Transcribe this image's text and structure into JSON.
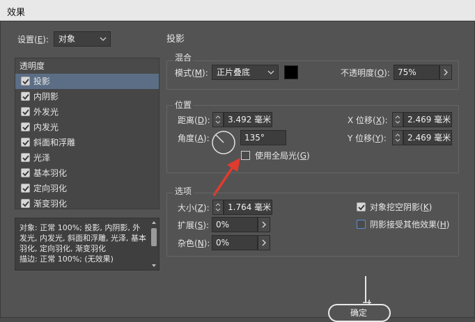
{
  "window": {
    "title": "效果"
  },
  "settings": {
    "label": "设置(",
    "key": "E",
    "suffix": "):",
    "value": "对象"
  },
  "left": {
    "header": "透明度",
    "items": [
      {
        "label": "投影",
        "checked": true,
        "selected": true
      },
      {
        "label": "内阴影",
        "checked": true,
        "selected": false
      },
      {
        "label": "外发光",
        "checked": true,
        "selected": false
      },
      {
        "label": "内发光",
        "checked": true,
        "selected": false
      },
      {
        "label": "斜面和浮雕",
        "checked": true,
        "selected": false
      },
      {
        "label": "光泽",
        "checked": true,
        "selected": false
      },
      {
        "label": "基本羽化",
        "checked": true,
        "selected": false
      },
      {
        "label": "定向羽化",
        "checked": true,
        "selected": false
      },
      {
        "label": "渐变羽化",
        "checked": true,
        "selected": false
      }
    ],
    "summary": "对象: 正常 100%; 投影, 内阴影, 外发光, 内发光, 斜面和浮雕, 光泽, 基本羽化, 定向羽化, 渐变羽化\n描边: 正常 100%; (无效果)"
  },
  "panel": {
    "title": "投影",
    "blend": {
      "title": "混合",
      "mode_label": "模式(",
      "mode_key": "M",
      "mode_suffix": "):",
      "mode_value": "正片叠底",
      "color": "#000000",
      "opacity_label": "不透明度(",
      "opacity_key": "O",
      "opacity_suffix": "):",
      "opacity_value": "75%"
    },
    "position": {
      "title": "位置",
      "distance_label": "距离(",
      "distance_key": "D",
      "distance_suffix": "):",
      "distance_value": "3.492 毫米",
      "angle_label": "角度(",
      "angle_key": "A",
      "angle_suffix": "):",
      "angle_value": "135°",
      "global_light_label": "使用全局光(",
      "global_light_key": "G",
      "global_light_suffix": ")",
      "x_offset_label": "X 位移(",
      "x_offset_key": "X",
      "x_offset_suffix": "):",
      "x_offset_value": "2.469 毫米",
      "y_offset_label": "Y 位移(",
      "y_offset_key": "Y",
      "y_offset_suffix": "):",
      "y_offset_value": "2.469 毫米"
    },
    "options": {
      "title": "选项",
      "size_label": "大小(",
      "size_key": "Z",
      "size_suffix": "):",
      "size_value": "1.764 毫米",
      "spread_label": "扩展(",
      "spread_key": "S",
      "spread_suffix": "):",
      "spread_value": "0%",
      "noise_label": "杂色(",
      "noise_key": "N",
      "noise_suffix": "):",
      "noise_value": "0%",
      "knockout_label": "对象挖空阴影(",
      "knockout_key": "K",
      "knockout_suffix": ")",
      "knockout_checked": true,
      "honor_label": "阴影接受其他效果(",
      "honor_key": "H",
      "honor_suffix": ")",
      "honor_checked": false
    }
  },
  "ok_label": "确定",
  "annotation_color": "#e23b2e"
}
